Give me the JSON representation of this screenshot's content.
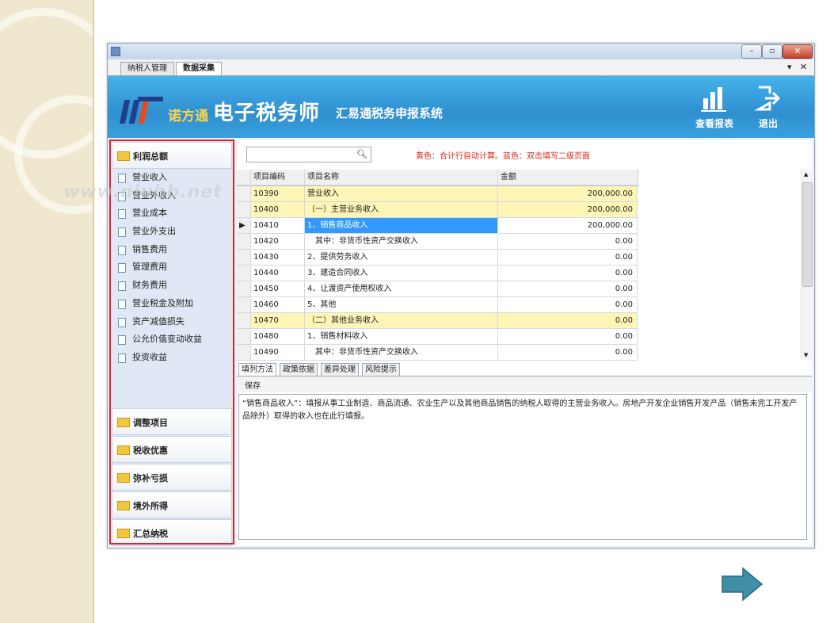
{
  "window": {
    "title": "",
    "tabs": [
      "纳税人管理",
      "数据采集"
    ],
    "active_tab": 1
  },
  "header": {
    "brand": "诺方通",
    "title": "电子税务师",
    "subtitle": "汇易通税务申报系统",
    "buttons": [
      {
        "label": "查看报表",
        "icon": "report-chart-icon"
      },
      {
        "label": "退出",
        "icon": "exit-icon"
      }
    ]
  },
  "watermark": "www.niubb.net",
  "sidebar": {
    "sections": [
      {
        "label": "利润总额",
        "expanded": true
      },
      {
        "label": "调整项目"
      },
      {
        "label": "税收优惠"
      },
      {
        "label": "弥补亏损"
      },
      {
        "label": "境外所得"
      },
      {
        "label": "汇总纳税"
      }
    ],
    "items": [
      "营业收入",
      "营业外收入",
      "营业成本",
      "营业外支出",
      "销售费用",
      "管理费用",
      "财务费用",
      "营业税金及附加",
      "资产减值损失",
      "公允价值变动收益",
      "投资收益"
    ]
  },
  "main": {
    "search_placeholder": "",
    "hint": "黄色：合计行自动计算。蓝色：双击填写二级页面",
    "columns": [
      "项目编码",
      "项目名称",
      "金额"
    ],
    "rows": [
      {
        "code": "10390",
        "name": "营业收入",
        "amount": "200,000.00",
        "style": "yellow"
      },
      {
        "code": "10400",
        "name": "（一）主营业务收入",
        "amount": "200,000.00",
        "style": "yellow"
      },
      {
        "code": "10410",
        "name": "1、销售商品收入",
        "amount": "200,000.00",
        "style": "selected"
      },
      {
        "code": "10420",
        "name": "　其中：非货币性资产交换收入",
        "amount": "0.00",
        "style": ""
      },
      {
        "code": "10430",
        "name": "2、提供劳务收入",
        "amount": "0.00",
        "style": ""
      },
      {
        "code": "10440",
        "name": "3、建造合同收入",
        "amount": "0.00",
        "style": ""
      },
      {
        "code": "10450",
        "name": "4、让渡资产使用权收入",
        "amount": "0.00",
        "style": ""
      },
      {
        "code": "10460",
        "name": "5、其他",
        "amount": "0.00",
        "style": ""
      },
      {
        "code": "10470",
        "name": "（二）其他业务收入",
        "amount": "0.00",
        "style": "yellow"
      },
      {
        "code": "10480",
        "name": "1、销售材料收入",
        "amount": "0.00",
        "style": ""
      },
      {
        "code": "10490",
        "name": "　其中：非货币性资产交换收入",
        "amount": "0.00",
        "style": ""
      }
    ],
    "bottom_tabs": [
      "填列方法",
      "政策依据",
      "差异处理",
      "风险提示"
    ],
    "active_bottom_tab": 0,
    "save_label": "保存",
    "description": "“销售商品收入”：填报从事工业制造、商品流通、农业生产以及其他商品销售的纳税人取得的主营业务收入。房地产开发企业销售开发产品（销售未完工开发产品除外）取得的收入也在此行填报。"
  },
  "colors": {
    "header_blue": "#2f8fd0",
    "yellow_row": "#fdf6b6",
    "selected_row": "#3399ff",
    "hint_red": "#d42a1a",
    "sidebar_highlight_border": "#d9242b",
    "next_arrow": "#3f8fa6"
  }
}
